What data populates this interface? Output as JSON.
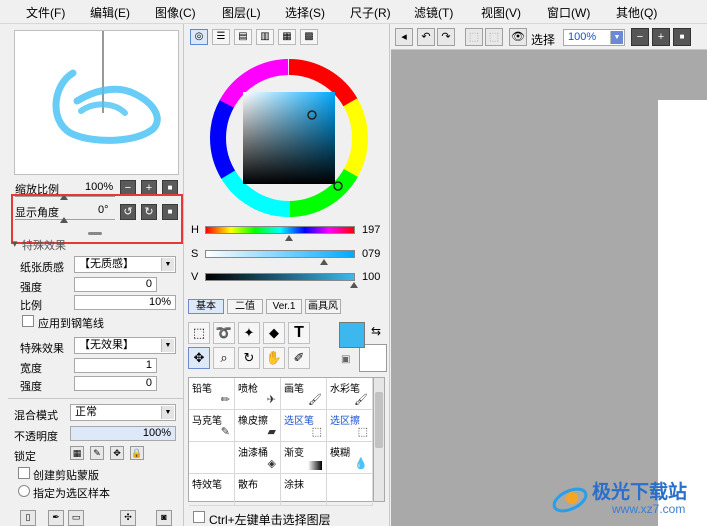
{
  "menu": {
    "file": "文件(F)",
    "edit": "编辑(E)",
    "image": "图像(C)",
    "layer": "图层(L)",
    "select": "选择(S)",
    "ruler": "尺子(R)",
    "filter": "滤镜(T)",
    "view": "视图(V)",
    "window": "窗口(W)",
    "other": "其他(Q)"
  },
  "navigator": {
    "zoom_label": "缩放比例",
    "zoom_value": "100%",
    "angle_label": "显示角度",
    "angle_value": "0°",
    "minus": "−",
    "plus": "+",
    "reset": "■",
    "rot_left": "↺",
    "rot_right": "↻"
  },
  "special_effects": {
    "header": "特殊效果",
    "paper_texture_label": "纸张质感",
    "paper_texture_value": "【无质感】",
    "strength_label": "强度",
    "strength_value": "0",
    "scale_label": "比例",
    "scale_value": "10%",
    "apply_brush_label": "应用到钢笔线",
    "effect_label": "特殊效果",
    "effect_value": "【无效果】",
    "width_label": "宽度",
    "width_value": "1",
    "effect_strength_label": "强度",
    "effect_strength_value": "0"
  },
  "layer": {
    "blend_label": "混合模式",
    "blend_value": "正常",
    "opacity_label": "不透明度",
    "opacity_value": "100%",
    "lock_label": "锁定",
    "clip_label": "创建剪贴蒙版",
    "selection_source_label": "指定为选区样本"
  },
  "color": {
    "h_label": "H",
    "h_value": "197",
    "s_label": "S",
    "s_value": "079",
    "v_label": "V",
    "v_value": "100",
    "primary": "#3cb8ee",
    "secondary": "#ffffff"
  },
  "tool_tabs": [
    "基本",
    "二值",
    "Ver.1",
    "画具风"
  ],
  "brushes": [
    "铅笔",
    "喷枪",
    "画笔",
    "水彩笔",
    "马克笔",
    "橡皮擦",
    "选区笔",
    "选区擦",
    "",
    "油漆桶",
    "渐变",
    "模糊",
    "特效笔",
    "散布",
    "涂抹",
    ""
  ],
  "bottom_hint": "Ctrl+左键单击选择图层",
  "canvas_toolbar": {
    "select_label": "选择",
    "zoom_value": "100%"
  },
  "watermark": "极光下载站",
  "watermark_url": "www.xz7.com"
}
